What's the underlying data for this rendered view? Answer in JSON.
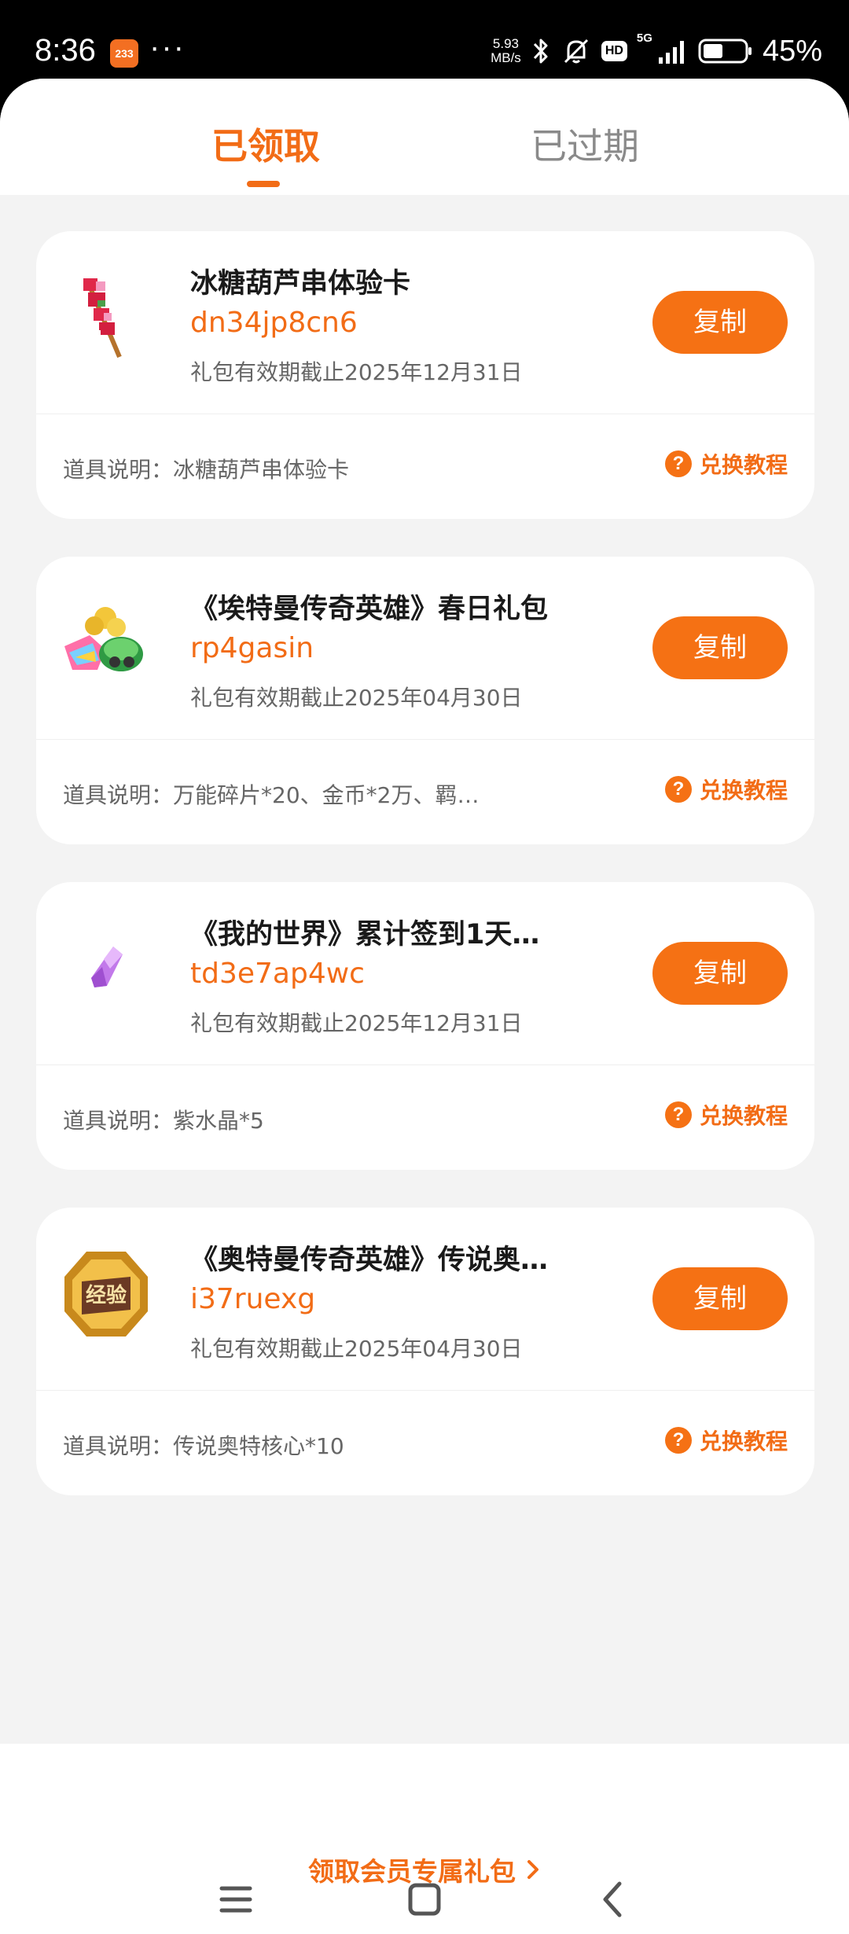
{
  "status_bar": {
    "time": "8:36",
    "app_badge": "233",
    "dots": "···",
    "net_speed_value": "5.93",
    "net_speed_unit": "MB/s",
    "hd": "HD",
    "signal_label": "5G",
    "battery_percent": "45%"
  },
  "tabs": {
    "active": "已领取",
    "inactive": "已过期"
  },
  "cards": [
    {
      "title": "冰糖葫芦串体验卡",
      "code": "dn34jp8cn6",
      "expiry": "礼包有效期截止2025年12月31日",
      "copy_label": "复制",
      "desc": "道具说明：冰糖葫芦串体验卡",
      "tutorial_label": "兑换教程",
      "icon": "candied-haws-icon"
    },
    {
      "title": "《埃特曼传奇英雄》春日礼包",
      "code": "rp4gasin",
      "expiry": "礼包有效期截止2025年04月30日",
      "copy_label": "复制",
      "desc": "道具说明：万能碎片*20、金币*2万、羁…",
      "tutorial_label": "兑换教程",
      "icon": "gift-bundle-icon"
    },
    {
      "title": "《我的世界》累计签到1天…",
      "code": "td3e7ap4wc",
      "expiry": "礼包有效期截止2025年12月31日",
      "copy_label": "复制",
      "desc": "道具说明：紫水晶*5",
      "tutorial_label": "兑换教程",
      "icon": "amethyst-crystal-icon"
    },
    {
      "title": "《奥特曼传奇英雄》传说奥…",
      "code": "i37ruexg",
      "expiry": "礼包有效期截止2025年04月30日",
      "copy_label": "复制",
      "desc": "道具说明：传说奥特核心*10",
      "tutorial_label": "兑换教程",
      "icon": "legend-core-icon",
      "icon_text": "经验"
    }
  ],
  "question_mark": "?",
  "promo": {
    "label": "领取会员专属礼包",
    "arrow": "›"
  },
  "colors": {
    "accent": "#f26c16",
    "button": "#f57114",
    "background": "#f3f3f3"
  }
}
